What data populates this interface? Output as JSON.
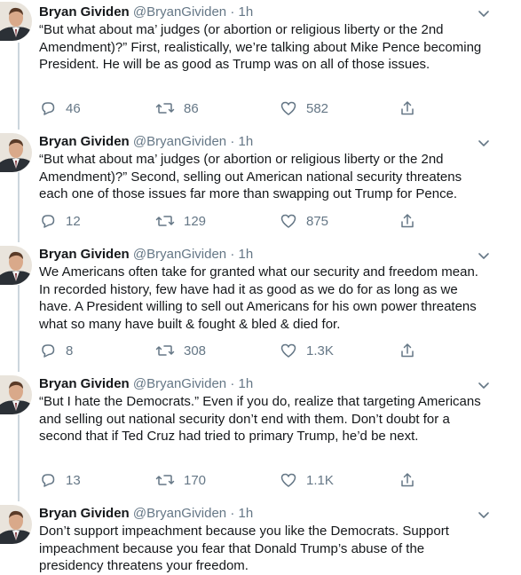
{
  "tweets": [
    {
      "name": "Bryan Gividen",
      "handle": "@BryanGividen",
      "time": "· 1h",
      "text": "“But what about ma’ judges (or abortion or religious liberty or the 2nd Amendment)?” First, realistically, we’re talking about Mike Pence becoming President. He will be as good as Trump was on all of those issues.",
      "replies": "46",
      "retweets": "86",
      "likes": "582"
    },
    {
      "name": "Bryan Gividen",
      "handle": "@BryanGividen",
      "time": "· 1h",
      "text": "“But what about ma’ judges (or abortion or religious liberty or the 2nd Amendment)?” Second, selling out American national security threatens each one of those issues far more than swapping out Trump for Pence.",
      "replies": "12",
      "retweets": "129",
      "likes": "875"
    },
    {
      "name": "Bryan Gividen",
      "handle": "@BryanGividen",
      "time": "· 1h",
      "text": "We Americans often take for granted what our security and freedom mean. In recorded history, few have had it as good as we do for as long as we have. A President willing to sell out Americans for his own power threatens what so many have built & fought & bled & died for.",
      "replies": "8",
      "retweets": "308",
      "likes": "1.3K"
    },
    {
      "name": "Bryan Gividen",
      "handle": "@BryanGividen",
      "time": "· 1h",
      "text": "“But I hate the Democrats.” Even if you do, realize that targeting Americans and selling out national security don’t end with them. Don’t doubt for a second that if Ted Cruz had tried to primary Trump, he’d be next.",
      "replies": "13",
      "retweets": "170",
      "likes": "1.1K"
    },
    {
      "name": "Bryan Gividen",
      "handle": "@BryanGividen",
      "time": "· 1h",
      "text": "Don’t support impeachment because you like the Democrats. Support impeachment because you fear that Donald Trump’s abuse of the presidency threatens your freedom."
    }
  ],
  "icons": {
    "reply": "reply-icon",
    "retweet": "retweet-icon",
    "like": "heart-icon",
    "share": "share-icon",
    "caret": "chevron-down-icon"
  },
  "colors": {
    "text": "#14171a",
    "secondary": "#657786",
    "thread_line": "#ccd6dd"
  }
}
